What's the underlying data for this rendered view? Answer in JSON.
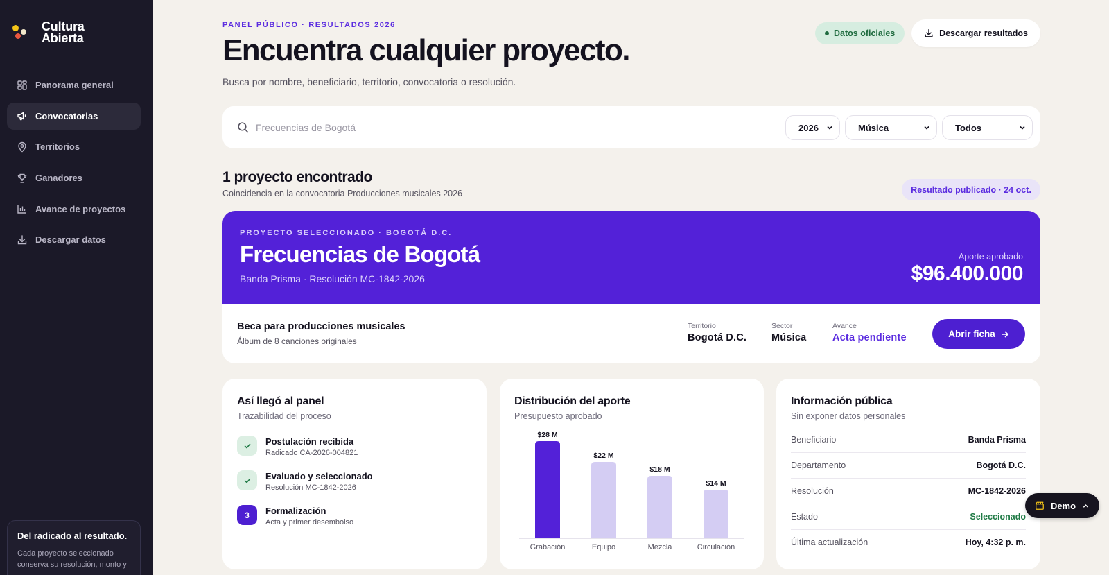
{
  "app": {
    "name": "Cultura Abierta"
  },
  "sidebar": {
    "items": [
      {
        "label": "Panorama general",
        "icon": "grid-icon"
      },
      {
        "label": "Convocatorias",
        "icon": "megaphone-icon",
        "active": true
      },
      {
        "label": "Territorios",
        "icon": "map-pin-icon"
      },
      {
        "label": "Ganadores",
        "icon": "trophy-icon"
      },
      {
        "label": "Avance de proyectos",
        "icon": "bar-chart-icon"
      },
      {
        "label": "Descargar datos",
        "icon": "download-icon"
      }
    ],
    "card": {
      "title": "Del radicado al resultado.",
      "text": "Cada proyecto seleccionado conserva su resolución, monto y"
    }
  },
  "header": {
    "eyebrow": "PANEL PÚBLICO · RESULTADOS 2026",
    "title": "Encuentra cualquier proyecto.",
    "subtitle": "Busca por nombre, beneficiario, territorio, convocatoria o resolución.",
    "badge_oficial": "Datos oficiales",
    "download_label": "Descargar resultados"
  },
  "search": {
    "placeholder": "Frecuencias de Bogotá",
    "year": "2026",
    "sector": "Música",
    "status": "Todos"
  },
  "results": {
    "title": "1 proyecto encontrado",
    "subtitle": "Coincidencia en la convocatoria Producciones musicales 2026",
    "published_badge": "Resultado publicado · 24 oct."
  },
  "project": {
    "eyebrow": "PROYECTO SELECCIONADO · BOGOTÁ D.C.",
    "title": "Frecuencias de Bogotá",
    "subtitle": "Banda Prisma · Resolución MC-1842-2026",
    "amount_label": "Aporte aprobado",
    "amount": "$96.400.000",
    "call_title": "Beca para producciones musicales",
    "call_sub": "Álbum de 8 canciones originales",
    "meta": [
      {
        "label": "Territorio",
        "value": "Bogotá D.C."
      },
      {
        "label": "Sector",
        "value": "Música"
      },
      {
        "label": "Avance",
        "value": "Acta pendiente"
      }
    ],
    "open_label": "Abrir ficha"
  },
  "process": {
    "title": "Así llegó al panel",
    "subtitle": "Trazabilidad del proceso",
    "steps": [
      {
        "title": "Postulación recibida",
        "sub": "Radicado CA-2026-004821",
        "state": "done"
      },
      {
        "title": "Evaluado y seleccionado",
        "sub": "Resolución MC-1842-2026",
        "state": "done"
      },
      {
        "title": "Formalización",
        "sub": "Acta y primer desembolso",
        "state": "current",
        "number": "3"
      }
    ]
  },
  "distribution": {
    "title": "Distribución del aporte",
    "subtitle": "Presupuesto aprobado"
  },
  "chart_data": {
    "type": "bar",
    "categories": [
      "Grabación",
      "Equipo",
      "Mezcla",
      "Circulación"
    ],
    "values": [
      28,
      22,
      18,
      14
    ],
    "data_labels": [
      "$28 M",
      "$22 M",
      "$18 M",
      "$14 M"
    ],
    "ylim": [
      0,
      28
    ],
    "colors": [
      "#5321d8",
      "#d4cdf3",
      "#d4cdf3",
      "#d4cdf3"
    ],
    "grid": false
  },
  "info": {
    "title": "Información pública",
    "subtitle": "Sin exponer datos personales",
    "rows": [
      {
        "label": "Beneficiario",
        "value": "Banda Prisma"
      },
      {
        "label": "Departamento",
        "value": "Bogotá D.C."
      },
      {
        "label": "Resolución",
        "value": "MC-1842-2026"
      },
      {
        "label": "Estado",
        "value": "Seleccionado"
      },
      {
        "label": "Última actualización",
        "value": "Hoy, 4:32 p. m."
      }
    ]
  },
  "demo": {
    "label": "Demo"
  },
  "colors": {
    "accent": "#5321d8",
    "sidebar": "#1b1928",
    "background": "#f4f1ec",
    "success": "#1f7a45"
  }
}
